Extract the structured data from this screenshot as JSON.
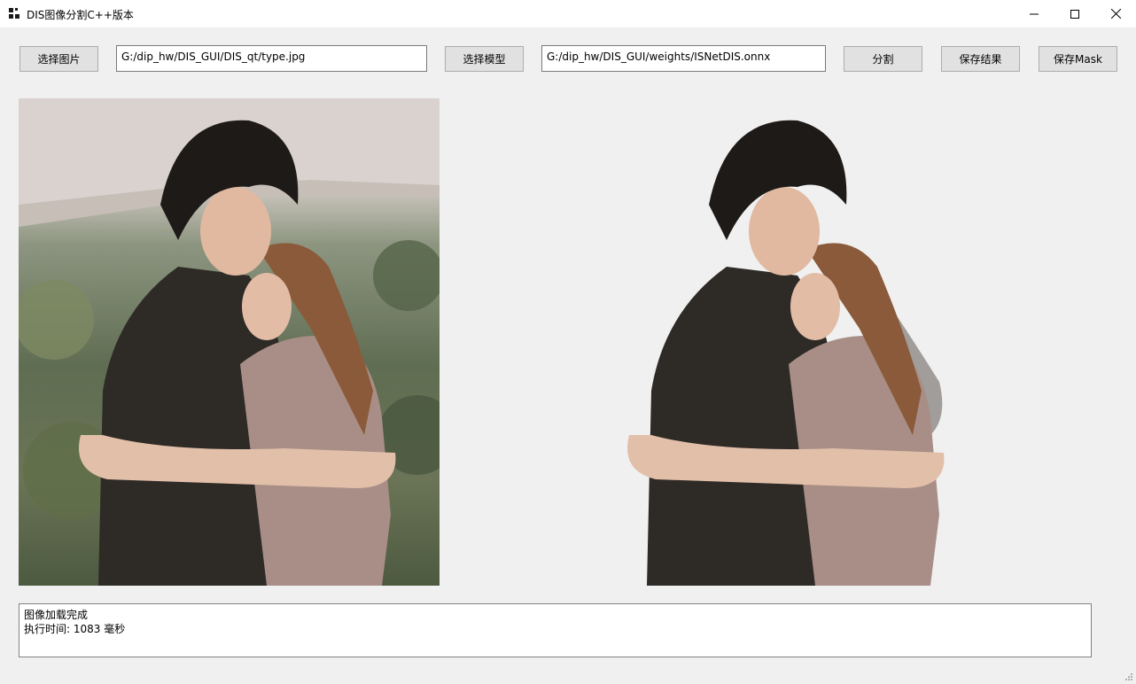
{
  "window": {
    "title": "DIS图像分割C++版本",
    "icon": "app-grid-icon",
    "controls": [
      "minimize-icon",
      "maximize-icon",
      "close-icon"
    ]
  },
  "toolbar": {
    "select_image_label": "选择图片",
    "image_path": "G:/dip_hw/DIS_GUI/DIS_qt/type.jpg",
    "select_model_label": "选择模型",
    "model_path": "G:/dip_hw/DIS_GUI/weights/ISNetDIS.onnx",
    "segment_label": "分割",
    "save_result_label": "保存结果",
    "save_mask_label": "保存Mask"
  },
  "panels": {
    "original": {
      "content": "photo of a couple hugging outdoors"
    },
    "result": {
      "content": "segmented couple with background removed"
    }
  },
  "log": {
    "lines": [
      "图像加载完成",
      "执行时间: 1083 毫秒"
    ]
  }
}
